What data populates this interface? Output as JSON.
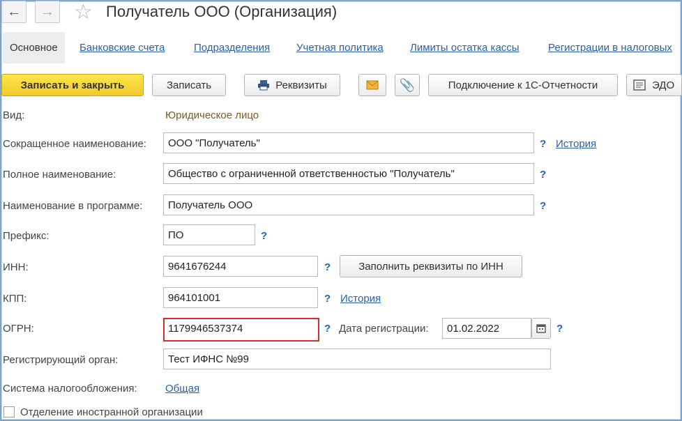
{
  "window": {
    "title": "Получатель ООО (Организация)"
  },
  "nav": {
    "back_icon": "←",
    "forward_icon": "→",
    "star_icon": "☆"
  },
  "tabs": [
    {
      "label": "Основное"
    },
    {
      "label": "Банковские счета"
    },
    {
      "label": "Подразделения"
    },
    {
      "label": "Учетная политика"
    },
    {
      "label": "Лимиты остатка кассы"
    },
    {
      "label": "Регистрации в налоговых"
    }
  ],
  "toolbar": {
    "save_close": "Записать и закрыть",
    "save": "Записать",
    "requisites": "Реквизиты",
    "connect": "Подключение к 1С-Отчетности",
    "edo": "ЭДО"
  },
  "form": {
    "vid_label": "Вид:",
    "vid_value": "Юридическое лицо",
    "short_name_label": "Сокращенное наименование:",
    "short_name_value": "ООО \"Получатель\"",
    "history_label": "История",
    "full_name_label": "Полное наименование:",
    "full_name_value": "Общество с ограниченной ответственностью \"Получатель\"",
    "prog_name_label": "Наименование в программе:",
    "prog_name_value": "Получатель ООО",
    "prefix_label": "Префикс:",
    "prefix_value": "ПО",
    "inn_label": "ИНН:",
    "inn_value": "9641676244",
    "fill_by_inn": "Заполнить реквизиты по ИНН",
    "kpp_label": "КПП:",
    "kpp_value": "964101001",
    "kpp_history": "История",
    "ogrn_label": "ОГРН:",
    "ogrn_value": "1179946537374",
    "reg_date_label": "Дата регистрации:",
    "reg_date_value": "01.02.2022",
    "reg_organ_label": "Регистрирующий орган:",
    "reg_organ_value": "Тест ИФНС №99",
    "tax_system_label": "Система налогообложения:",
    "tax_system_value": "Общая",
    "foreign_label": "Отделение иностранной организации",
    "help": "?"
  }
}
